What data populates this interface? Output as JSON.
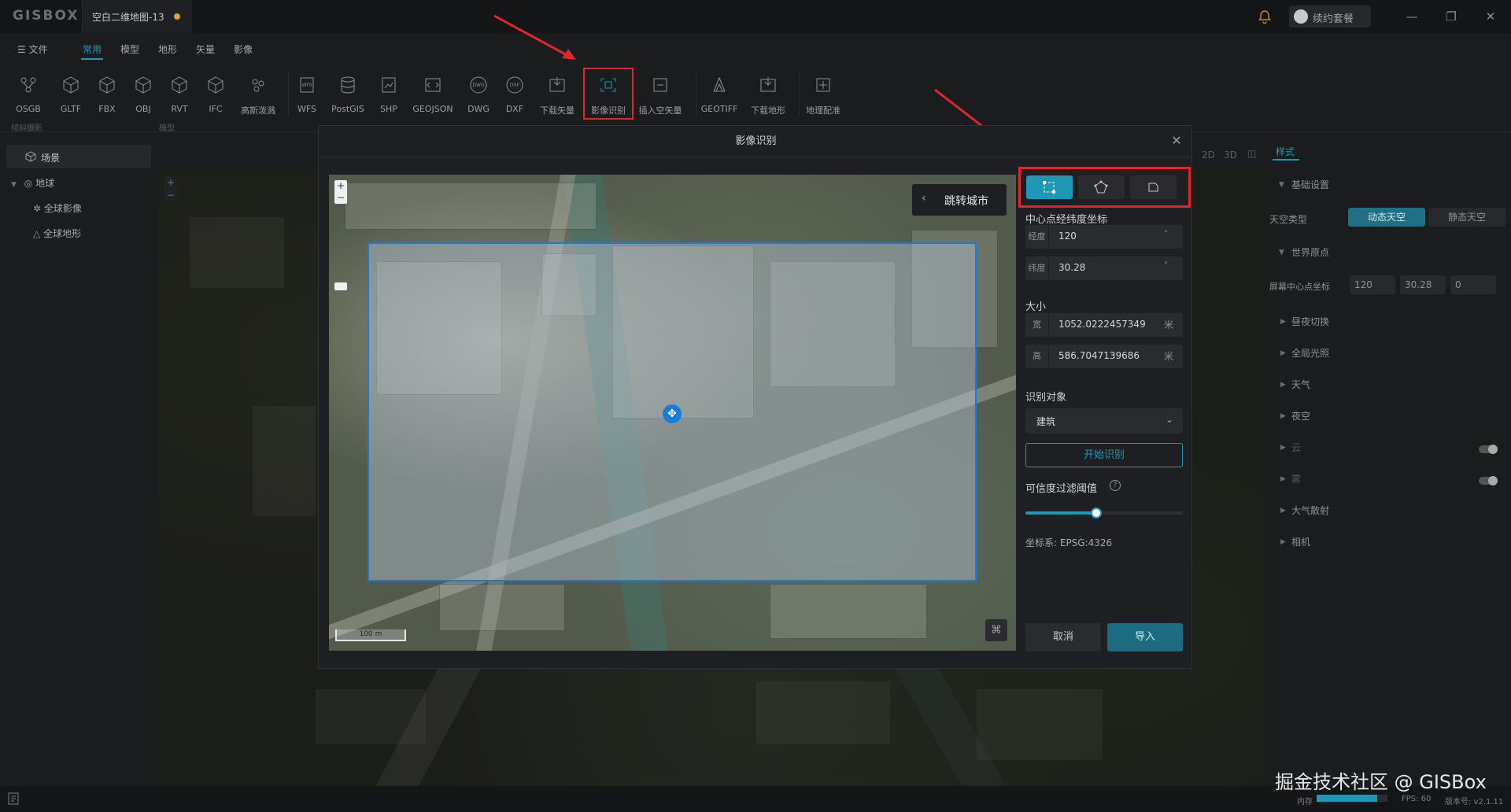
{
  "app": {
    "logo": "GISBOX",
    "doc_title": "空白二维地图-13",
    "renew_label": "续约套餐",
    "window_controls": {
      "minimize": "—",
      "restore": "❐",
      "close": "✕"
    }
  },
  "menu": {
    "file": "☰ 文件",
    "tabs": [
      "常用",
      "模型",
      "地形",
      "矢量",
      "影像"
    ],
    "active_tab": "常用"
  },
  "ribbon": {
    "buttons": [
      "OSGB",
      "GLTF",
      "FBX",
      "OBJ",
      "RVT",
      "IFC",
      "高斯泼溅",
      "WFS",
      "PostGIS",
      "SHP",
      "GEOJSON",
      "DWG",
      "DXF",
      "下载矢量",
      "影像识别",
      "插入空矢量",
      "GEOTIFF",
      "下载地形",
      "地理配准"
    ],
    "highlighted": "影像识别",
    "groups": [
      "倾斜摄影",
      "模型"
    ]
  },
  "left_panel": {
    "scene_label": "场景",
    "tree": {
      "earth": "地球",
      "global_imagery": "全球影像",
      "global_terrain": "全球地形"
    }
  },
  "right_panel": {
    "view_modes": [
      "2D",
      "3D",
      "◫"
    ],
    "tab": "样式",
    "basic_settings": "基础设置",
    "sky_type_label": "天空类型",
    "sky_dynamic": "动态天空",
    "sky_static": "静态天空",
    "world_origin": "世界原点",
    "screen_center_label": "屏幕中心点坐标",
    "screen_center_values": [
      "120",
      "30.28",
      "0"
    ],
    "sections": [
      "昼夜切换",
      "全局光照",
      "天气",
      "夜空",
      "云",
      "雾",
      "大气散射",
      "相机"
    ]
  },
  "dialog": {
    "title": "影像识别",
    "jump_city": "跳转城市",
    "scale_label": "100 m",
    "center_label": "中心点经纬度坐标",
    "lon_prefix": "经度",
    "lon_value": "120",
    "lat_prefix": "纬度",
    "lat_value": "30.28",
    "size_label": "大小",
    "width_prefix": "宽",
    "width_value": "1052.0222457349",
    "height_prefix": "高",
    "height_value": "586.7047139686",
    "unit": "米",
    "target_label": "识别对象",
    "target_value": "建筑",
    "start_button": "开始识别",
    "confidence_label": "可信度过滤阈值",
    "confidence_value": 0.45,
    "crs": "坐标系: EPSG:4326",
    "cancel": "取消",
    "import": "导入"
  },
  "status": {
    "watermark": "掘金技术社区 @ GISBox",
    "memory_label": "内存",
    "memory_fraction": 0.85,
    "fps": "FPS: 60",
    "version": "版本号: v2.1.11"
  },
  "colors": {
    "accent": "#1f98b7",
    "highlight_red": "#e0252d",
    "selection_blue": "#1a7bd8"
  }
}
